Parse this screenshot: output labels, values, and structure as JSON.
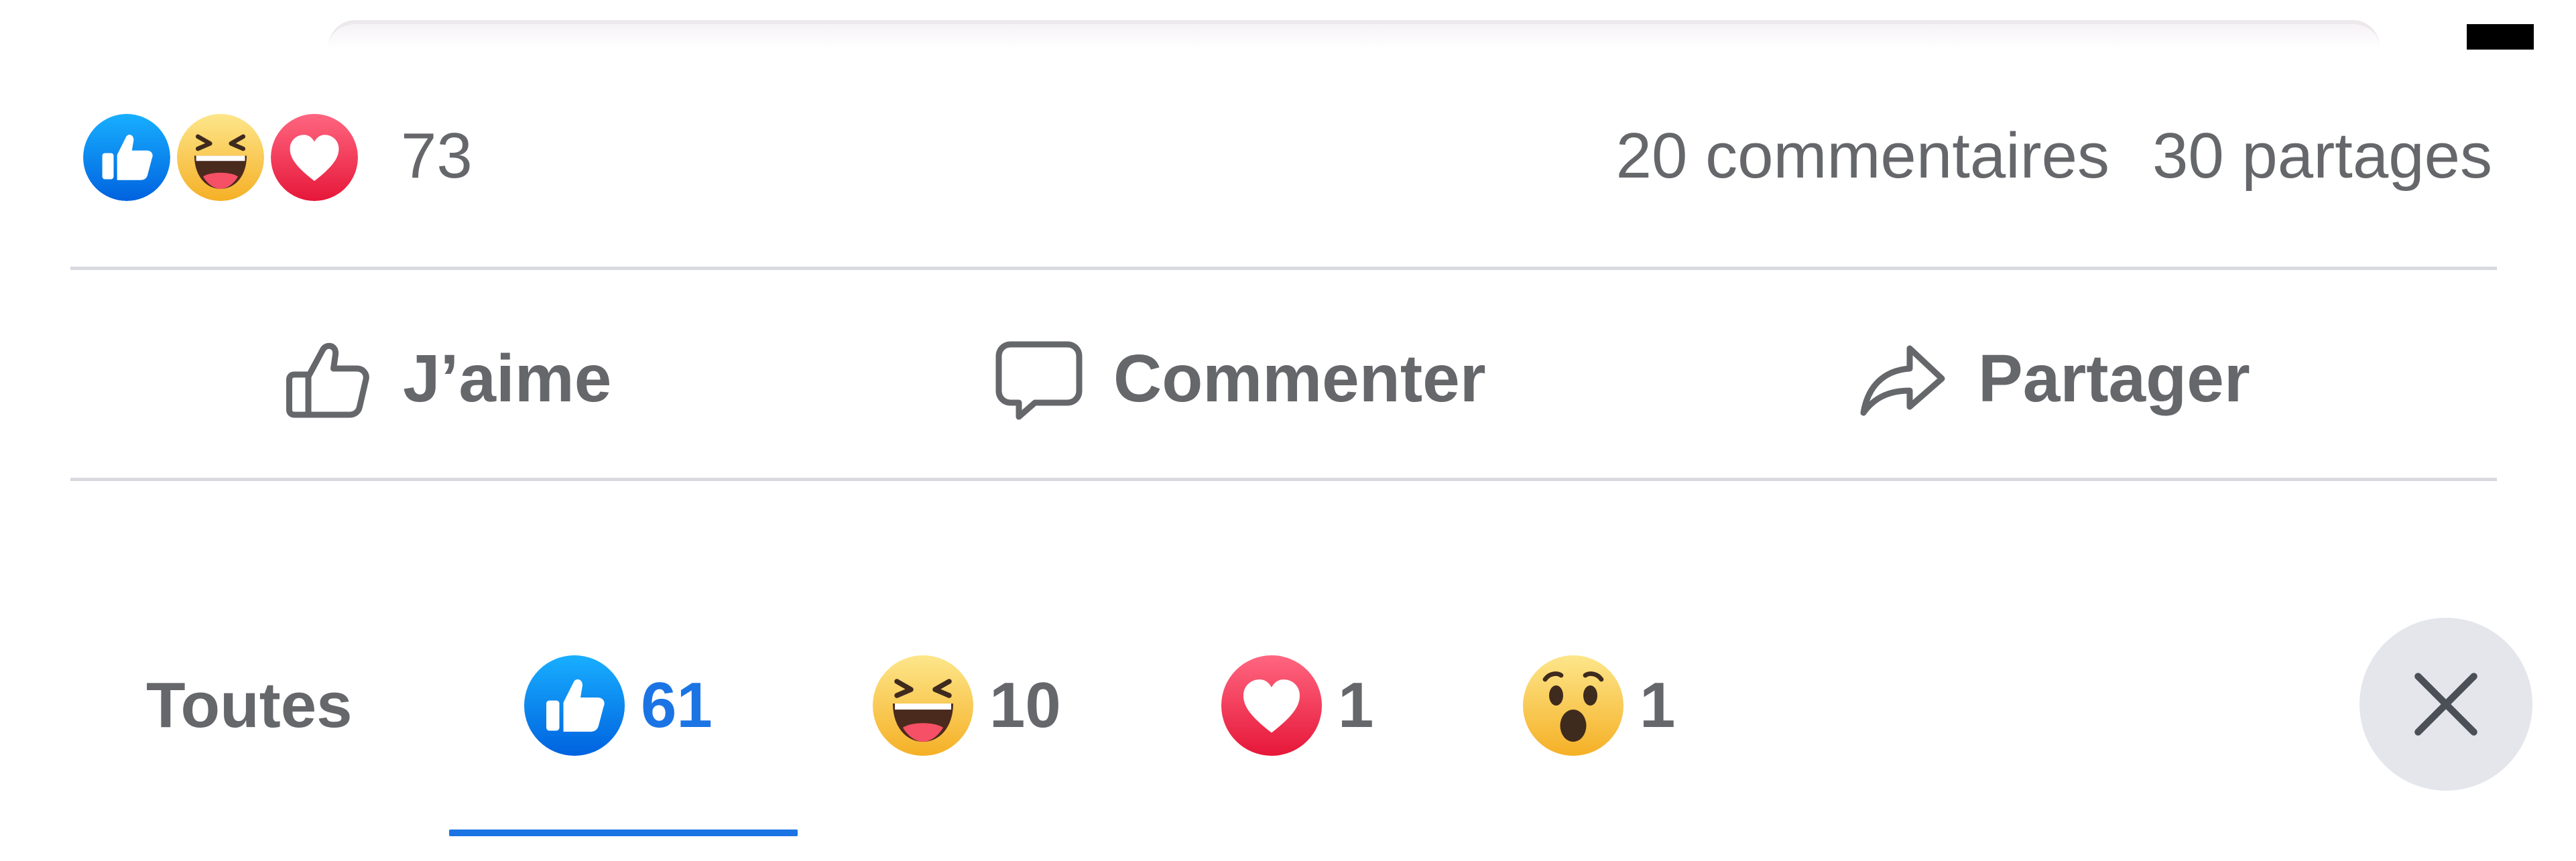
{
  "summary": {
    "reaction_icons": [
      "like-icon",
      "haha-icon",
      "love-icon"
    ],
    "reaction_total": "73",
    "comments": "20 commentaires",
    "shares": "30 partages"
  },
  "actions": {
    "like_label": "J’aime",
    "comment_label": "Commenter",
    "share_label": "Partager"
  },
  "tabs": {
    "all_label": "Toutes",
    "like_count": "61",
    "haha_count": "10",
    "love_count": "1",
    "wow_count": "1",
    "active_tab": "like"
  },
  "colors": {
    "accent_blue": "#1b74e4",
    "text_gray": "#65676b",
    "divider": "#d8dadf",
    "close_bg": "#e4e6eb",
    "love_red": "#f0284a",
    "haha_yellow": "#f7c33b"
  },
  "icons": {
    "close": "close-icon"
  }
}
